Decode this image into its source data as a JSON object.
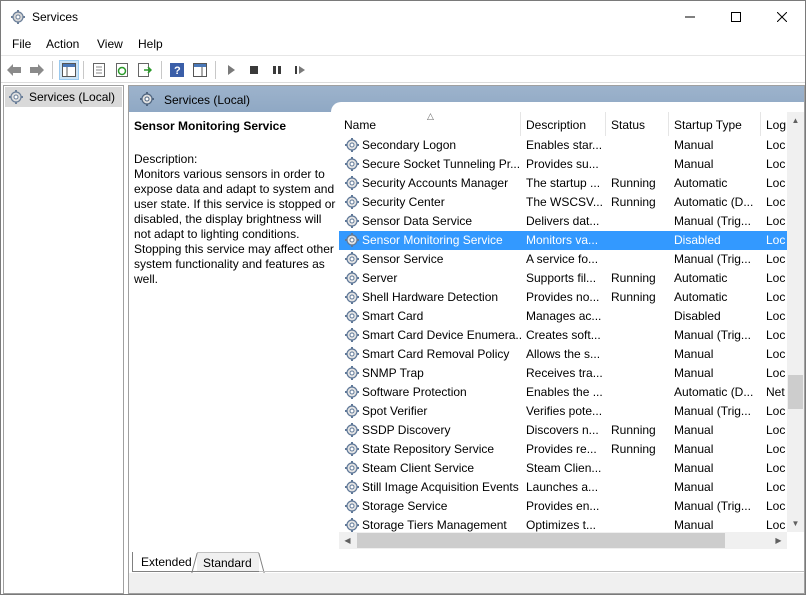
{
  "window": {
    "title": "Services"
  },
  "menu": [
    "File",
    "Action",
    "View",
    "Help"
  ],
  "tree": {
    "root_label": "Services (Local)"
  },
  "panel": {
    "header": "Services (Local)"
  },
  "description": {
    "service_name": "Sensor Monitoring Service",
    "label": "Description:",
    "text": "Monitors various sensors in order to expose data and adapt to system and user state.  If this service is stopped or disabled, the display brightness will not adapt to lighting conditions. Stopping this service may affect other system functionality and features as well."
  },
  "columns": [
    "Name",
    "Description",
    "Status",
    "Startup Type",
    "Log"
  ],
  "rows": [
    {
      "name": "Secondary Logon",
      "desc": "Enables star...",
      "status": "",
      "startup": "Manual",
      "log": "Loc"
    },
    {
      "name": "Secure Socket Tunneling Pr...",
      "desc": "Provides su...",
      "status": "",
      "startup": "Manual",
      "log": "Loc"
    },
    {
      "name": "Security Accounts Manager",
      "desc": "The startup ...",
      "status": "Running",
      "startup": "Automatic",
      "log": "Loc"
    },
    {
      "name": "Security Center",
      "desc": "The WSCSV...",
      "status": "Running",
      "startup": "Automatic (D...",
      "log": "Loc"
    },
    {
      "name": "Sensor Data Service",
      "desc": "Delivers dat...",
      "status": "",
      "startup": "Manual (Trig...",
      "log": "Loc"
    },
    {
      "name": "Sensor Monitoring Service",
      "desc": "Monitors va...",
      "status": "",
      "startup": "Disabled",
      "log": "Loc",
      "selected": true
    },
    {
      "name": "Sensor Service",
      "desc": "A service fo...",
      "status": "",
      "startup": "Manual (Trig...",
      "log": "Loc"
    },
    {
      "name": "Server",
      "desc": "Supports fil...",
      "status": "Running",
      "startup": "Automatic",
      "log": "Loc"
    },
    {
      "name": "Shell Hardware Detection",
      "desc": "Provides no...",
      "status": "Running",
      "startup": "Automatic",
      "log": "Loc"
    },
    {
      "name": "Smart Card",
      "desc": "Manages ac...",
      "status": "",
      "startup": "Disabled",
      "log": "Loc"
    },
    {
      "name": "Smart Card Device Enumera...",
      "desc": "Creates soft...",
      "status": "",
      "startup": "Manual (Trig...",
      "log": "Loc"
    },
    {
      "name": "Smart Card Removal Policy",
      "desc": "Allows the s...",
      "status": "",
      "startup": "Manual",
      "log": "Loc"
    },
    {
      "name": "SNMP Trap",
      "desc": "Receives tra...",
      "status": "",
      "startup": "Manual",
      "log": "Loc"
    },
    {
      "name": "Software Protection",
      "desc": "Enables the ...",
      "status": "",
      "startup": "Automatic (D...",
      "log": "Net"
    },
    {
      "name": "Spot Verifier",
      "desc": "Verifies pote...",
      "status": "",
      "startup": "Manual (Trig...",
      "log": "Loc"
    },
    {
      "name": "SSDP Discovery",
      "desc": "Discovers n...",
      "status": "Running",
      "startup": "Manual",
      "log": "Loc"
    },
    {
      "name": "State Repository Service",
      "desc": "Provides re...",
      "status": "Running",
      "startup": "Manual",
      "log": "Loc"
    },
    {
      "name": "Steam Client Service",
      "desc": "Steam Clien...",
      "status": "",
      "startup": "Manual",
      "log": "Loc"
    },
    {
      "name": "Still Image Acquisition Events",
      "desc": "Launches a...",
      "status": "",
      "startup": "Manual",
      "log": "Loc"
    },
    {
      "name": "Storage Service",
      "desc": "Provides en...",
      "status": "",
      "startup": "Manual (Trig...",
      "log": "Loc"
    },
    {
      "name": "Storage Tiers Management",
      "desc": "Optimizes t...",
      "status": "",
      "startup": "Manual",
      "log": "Loc"
    }
  ],
  "scroll": {
    "vertical_position": 0.66,
    "horizontal_visible": 0.85
  },
  "tabs": [
    "Extended",
    "Standard"
  ],
  "colors": {
    "selection": "#3399ff",
    "panel_header": "#9db3cc"
  }
}
